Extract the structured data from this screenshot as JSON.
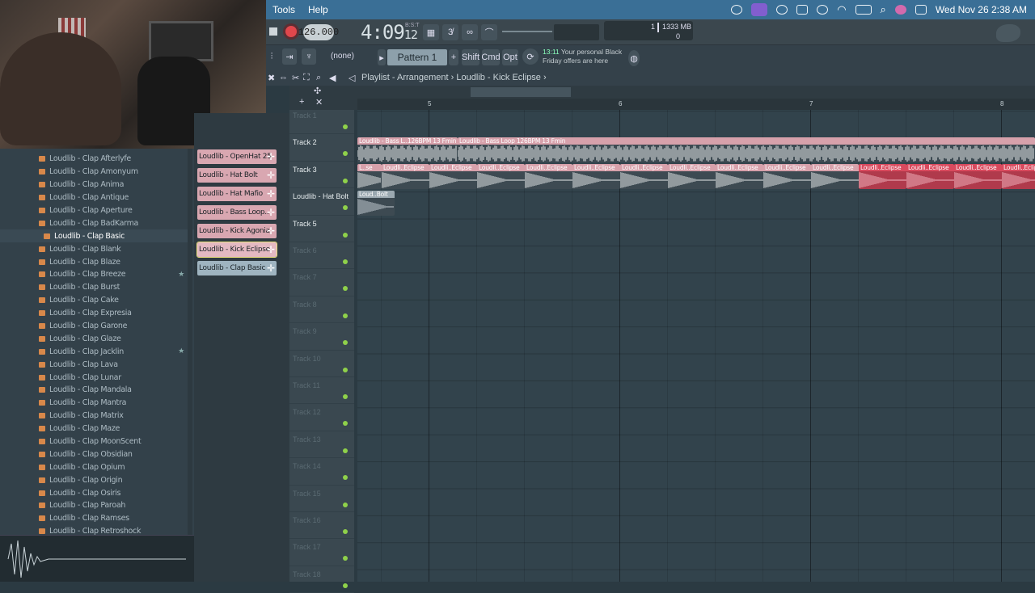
{
  "menubar": {
    "items": [
      "Tools",
      "Help"
    ],
    "datetime": "Wed Nov 26  2:38 AM"
  },
  "transport": {
    "tempo": "126.000",
    "time_main": "4:09",
    "time_sub": "12",
    "time_label": "B:S:T",
    "memory": "1333 MB",
    "memory_count": "1",
    "memory_zero": "0"
  },
  "toolbar": {
    "pattern_selector": "(none)",
    "pattern_name": "Pattern 1",
    "shift_label": "Shift",
    "cmd_label": "Cmd",
    "opt_label": "Opt",
    "promo_time": "13:11",
    "promo_text": "Your personal Black Friday offers are here"
  },
  "playlist": {
    "breadcrumb": "Playlist - Arrangement  ›  Loudlib - Kick Eclipse  ›",
    "ruler": [
      "5",
      "6",
      "7",
      "8"
    ]
  },
  "browser": {
    "items": [
      {
        "label": "Loudlib - Clap Afterlyfe",
        "star": false
      },
      {
        "label": "Loudlib - Clap Amonyum",
        "star": false
      },
      {
        "label": "Loudlib - Clap Anima",
        "star": false
      },
      {
        "label": "Loudlib - Clap Antique",
        "star": false
      },
      {
        "label": "Loudlib - Clap Aperture",
        "star": false
      },
      {
        "label": "Loudlib - Clap BadKarma",
        "star": false
      },
      {
        "label": "Loudlib - Clap Basic",
        "star": false,
        "selected": true
      },
      {
        "label": "Loudlib - Clap Blank",
        "star": false
      },
      {
        "label": "Loudlib - Clap Blaze",
        "star": false
      },
      {
        "label": "Loudlib - Clap Breeze",
        "star": true
      },
      {
        "label": "Loudlib - Clap Burst",
        "star": false
      },
      {
        "label": "Loudlib - Clap Cake",
        "star": false
      },
      {
        "label": "Loudlib - Clap Expresia",
        "star": false
      },
      {
        "label": "Loudlib - Clap Garone",
        "star": false
      },
      {
        "label": "Loudlib - Clap Glaze",
        "star": false
      },
      {
        "label": "Loudlib - Clap Jacklin",
        "star": true
      },
      {
        "label": "Loudlib - Clap Lava",
        "star": false
      },
      {
        "label": "Loudlib - Clap Lunar",
        "star": false
      },
      {
        "label": "Loudlib - Clap Mandala",
        "star": false
      },
      {
        "label": "Loudlib - Clap Mantra",
        "star": false
      },
      {
        "label": "Loudlib - Clap Matrix",
        "star": false
      },
      {
        "label": "Loudlib - Clap Maze",
        "star": false
      },
      {
        "label": "Loudlib - Clap MoonScent",
        "star": false
      },
      {
        "label": "Loudlib - Clap Obsidian",
        "star": false
      },
      {
        "label": "Loudlib - Clap Opium",
        "star": false
      },
      {
        "label": "Loudlib - Clap Origin",
        "star": false
      },
      {
        "label": "Loudlib - Clap Osiris",
        "star": false
      },
      {
        "label": "Loudlib - Clap Paroah",
        "star": false
      },
      {
        "label": "Loudlib - Clap Ramses",
        "star": false
      },
      {
        "label": "Loudlib - Clap Retroshock",
        "star": false
      }
    ]
  },
  "channels": [
    {
      "label": "Loudlib - OpenHat 25",
      "color": "#d9a7b1"
    },
    {
      "label": "Loudlib - Hat Bolt",
      "color": "#d9a7b1"
    },
    {
      "label": "Loudlib - Hat Mafio",
      "color": "#d9a7b1"
    },
    {
      "label": "Loudlib - Bass Loop..",
      "color": "#d9a7b1"
    },
    {
      "label": "Loudlib - Kick Agonia",
      "color": "#d9a7b1"
    },
    {
      "label": "Loudlib - Kick Eclipse",
      "color": "#e4b9c2",
      "selected": true
    },
    {
      "label": "Loudlib - Clap Basic",
      "color": "#9fb4c0"
    }
  ],
  "tracks": [
    {
      "label": "Track 1",
      "dim": true
    },
    {
      "label": "Track 2",
      "dim": false
    },
    {
      "label": "Track 3",
      "dim": false
    },
    {
      "label": "Loudlib - Hat Bolt",
      "dim": false
    },
    {
      "label": "Track 5",
      "dim": false
    },
    {
      "label": "Track 6",
      "dim": true
    },
    {
      "label": "Track 7",
      "dim": true
    },
    {
      "label": "Track 8",
      "dim": true
    },
    {
      "label": "Track 9",
      "dim": true
    },
    {
      "label": "Track 10",
      "dim": true
    },
    {
      "label": "Track 11",
      "dim": true
    },
    {
      "label": "Track 12",
      "dim": true
    },
    {
      "label": "Track 13",
      "dim": true
    },
    {
      "label": "Track 14",
      "dim": true
    },
    {
      "label": "Track 15",
      "dim": true
    },
    {
      "label": "Track 16",
      "dim": true
    },
    {
      "label": "Track 17",
      "dim": true
    },
    {
      "label": "Track 18",
      "dim": true
    }
  ],
  "clips": {
    "bass_a": "Loudlib - Bass L..126BPM 13 Fmin",
    "bass_b": "Loudlib - Bass Loop 126BPM 13 Fmin",
    "kick_first": "L..se",
    "kick": "Loudli..Eclipse",
    "hat": "Loud..Bolt"
  },
  "colors": {
    "accent": "#3a6f96",
    "clip_pink": "#d7a1ab",
    "clip_red": "#d94a5e",
    "track_dot": "#8fd14a"
  }
}
